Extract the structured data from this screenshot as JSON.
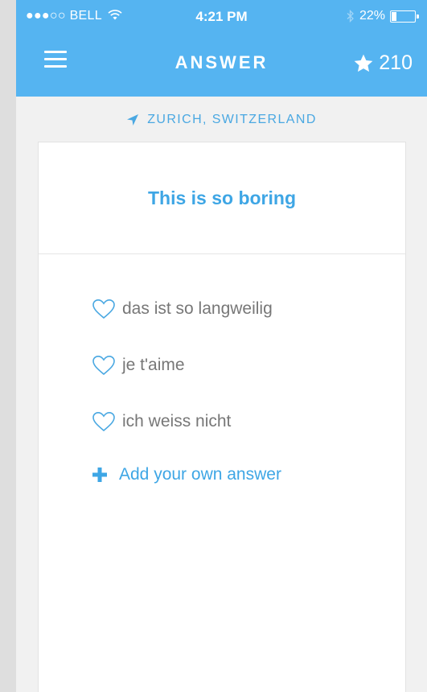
{
  "status_bar": {
    "carrier": "●●●○○ BELL",
    "time": "4:21 PM",
    "battery": "22%",
    "battery_level": 0.22
  },
  "nav": {
    "title": "ANSWER",
    "stars": "210"
  },
  "location": "ZURICH, SWITZERLAND",
  "question": "This is so boring",
  "answers": [
    {
      "text": "das ist so langweilig"
    },
    {
      "text": "je t'aime"
    },
    {
      "text": "ich weiss nicht"
    }
  ],
  "add_answer_label": "Add your own answer",
  "colors": {
    "accent": "#55b4f1",
    "accent_text": "#3ea6e5",
    "answer_text": "#777777",
    "background": "#f1f1f1"
  },
  "icons": {
    "menu": "hamburger-menu-icon",
    "star": "star-icon",
    "location": "location-arrow-icon",
    "heart": "heart-outline-icon",
    "add": "plus-icon",
    "wifi": "wifi-icon",
    "bluetooth": "bluetooth-icon",
    "battery": "battery-icon"
  }
}
